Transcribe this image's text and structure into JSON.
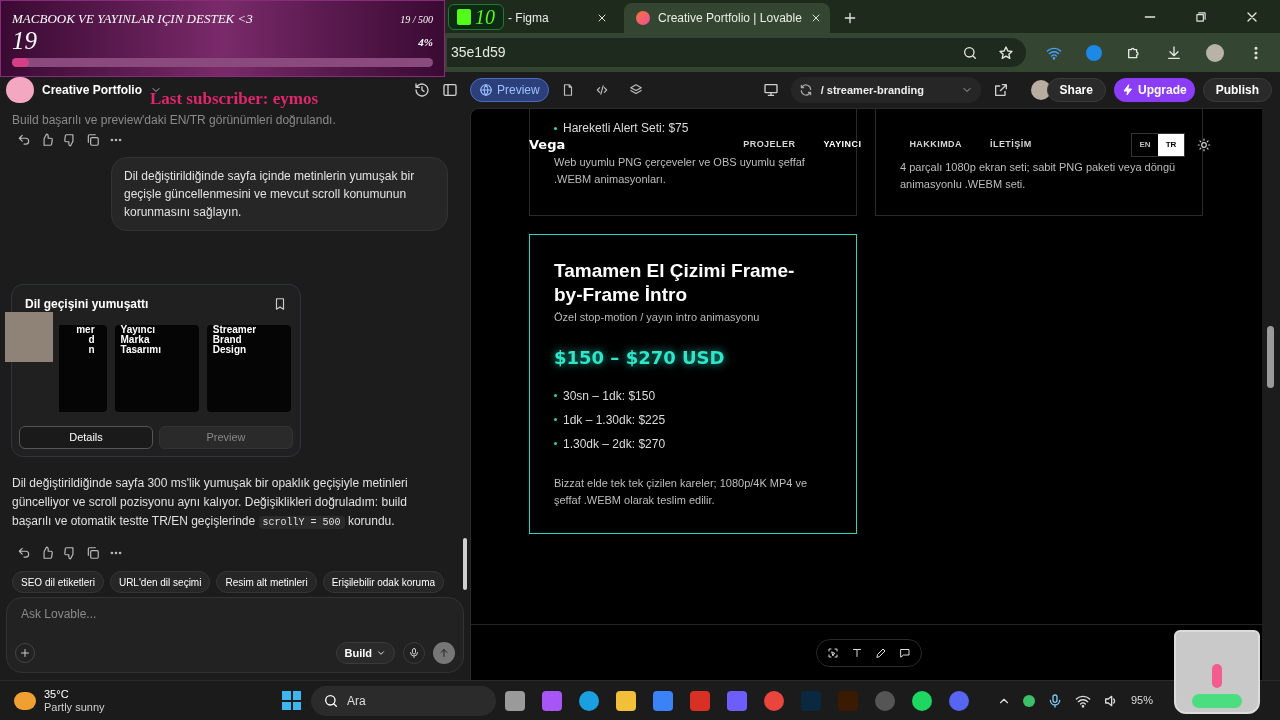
{
  "goal": {
    "title": "MACBOOK VE YAYINLAR IÇIN DESTEK <3",
    "count": "19",
    "progress_text": "19 / 500",
    "percent": "4%",
    "level": 0.04
  },
  "browser": {
    "counter_badge": "10",
    "tabs": [
      {
        "title": "- Figma",
        "selected": false
      },
      {
        "title": "Creative Portfolio | Lovable",
        "selected": true
      }
    ],
    "address": "35e1d59"
  },
  "project": {
    "name": "Creative Portfolio",
    "view_tabs": [
      {
        "kind": "preview",
        "label": "Preview",
        "selected": true
      },
      {
        "kind": "file",
        "selected": false
      },
      {
        "kind": "code",
        "selected": false
      },
      {
        "kind": "layers",
        "selected": false
      }
    ],
    "route": "/ streamer-branding",
    "share": "Share",
    "upgrade": "Upgrade",
    "publish": "Publish"
  },
  "last_subscriber": "Last subscriber: eymos",
  "chat": {
    "earlier_text": "Build başarılı ve preview'daki EN/TR görünümleri doğrulandı.",
    "user_message": "Dil değiştirildiğinde sayfa içinde metinlerin yumuşak bir geçişle güncellenmesini ve mevcut scroll konumunun korunmasını sağlayın.",
    "card": {
      "title": "Dil geçişini yumuşattı",
      "thumbnails": [
        {
          "lines": [
            "mer",
            "d",
            "n"
          ]
        },
        {
          "lines": [
            "Yayıncı",
            "Marka",
            "Tasarımı"
          ]
        },
        {
          "lines": [
            "Streamer",
            "Brand",
            "Design"
          ]
        }
      ],
      "buttons": [
        {
          "label": "Details",
          "selected": true
        },
        {
          "label": "Preview",
          "selected": false
        }
      ]
    },
    "reply": {
      "before": "Dil değiştirildiğinde sayfa 300 ms'lik yumuşak bir opaklık geçişiyle metinleri güncelliyor ve scroll pozisyonu aynı kalıyor. Değişiklikleri doğruladım: build başarılı ve otomatik testte TR/EN geçişlerinde",
      "code": "scrollY = 500",
      "after": "korundu."
    },
    "suggestions": [
      "SEO dil etiketleri",
      "URL'den dil seçimi",
      "Resim alt metinleri",
      "Erişilebilir odak koruma"
    ],
    "input": {
      "placeholder": "Ask Lovable...",
      "mode": "Build"
    }
  },
  "preview": {
    "nav": {
      "logo": "Vega",
      "links": [
        "PROJELER",
        "YAYINCI",
        "HAKKIMDA",
        "İLETİŞİM"
      ],
      "languages": [
        {
          "label": "EN",
          "selected": false
        },
        {
          "label": "TR",
          "selected": true
        }
      ]
    },
    "cards": [
      {
        "highlighted": false,
        "bullets": [
          "Hareketli Alert Seti: $75"
        ],
        "note": "Web uyumlu PNG çerçeveler ve OBS uyumlu şeffaf .WEBM animasyonları."
      },
      {
        "highlighted": false,
        "note": "4 parçalı 1080p ekran seti; sabit PNG paketi veya döngü animasyonlu .WEBM seti."
      },
      {
        "highlighted": true,
        "title": "Tamamen El Çizimi Frame-by-Frame İntro",
        "subtitle": "Özel stop-motion / yayın intro animasyonu",
        "price": "$150 – $270 USD",
        "bullets": [
          "30sn – 1dk: $150",
          "1dk – 1.30dk: $225",
          "1.30dk – 2dk: $270"
        ],
        "note": "Bizzat elde tek tek çizilen kareler; 1080p/4K MP4 ve şeffaf .WEBM olarak teslim edilir."
      }
    ]
  },
  "taskbar": {
    "temperature": "35°C",
    "condition": "Partly sunny",
    "search_placeholder": "Ara",
    "battery": "95%"
  }
}
